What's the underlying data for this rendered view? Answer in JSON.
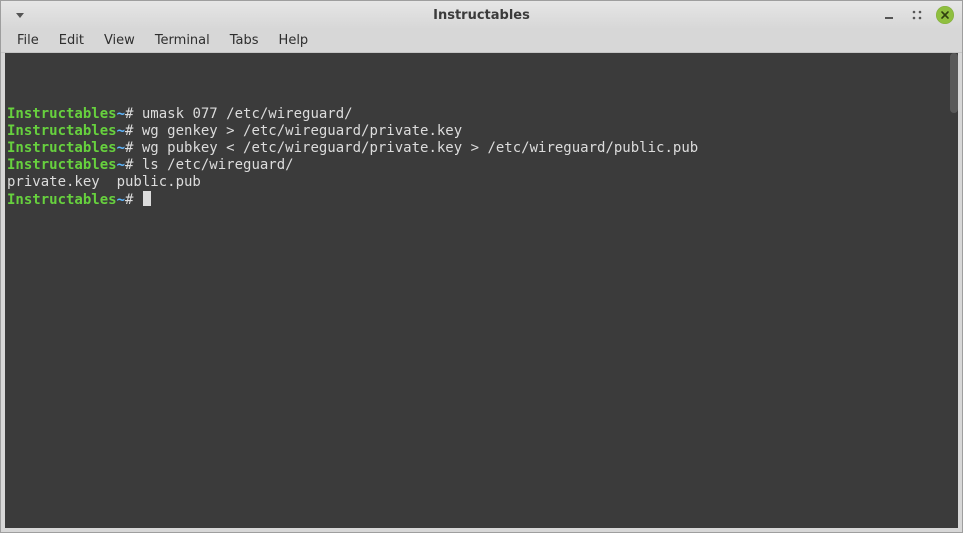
{
  "window": {
    "title": "Instructables"
  },
  "menu": {
    "file": "File",
    "edit": "Edit",
    "view": "View",
    "terminal": "Terminal",
    "tabs": "Tabs",
    "help": "Help"
  },
  "prompt": {
    "host": "Instructables",
    "sep": "~",
    "symbol": "#"
  },
  "lines": [
    {
      "type": "cmd",
      "text": "umask 077 /etc/wireguard/"
    },
    {
      "type": "cmd",
      "text": "wg genkey > /etc/wireguard/private.key"
    },
    {
      "type": "cmd",
      "text": "wg pubkey < /etc/wireguard/private.key > /etc/wireguard/public.pub"
    },
    {
      "type": "cmd",
      "text": "ls /etc/wireguard/"
    },
    {
      "type": "output",
      "text": "private.key  public.pub"
    },
    {
      "type": "prompt",
      "text": ""
    }
  ]
}
